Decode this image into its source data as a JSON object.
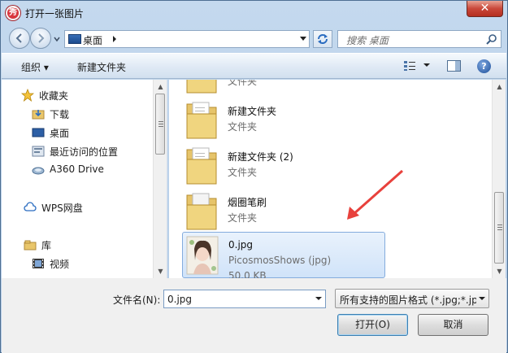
{
  "window": {
    "title": "打开一张图片",
    "app_icon_glyph": "秀",
    "close_glyph": "✕"
  },
  "navbar": {
    "address": "桌面",
    "search_placeholder": "搜索 桌面"
  },
  "toolbar": {
    "organize": "组织 ▾",
    "new_folder": "新建文件夹"
  },
  "sidebar": {
    "items": [
      {
        "label": "收藏夹",
        "icon": "star-icon"
      },
      {
        "label": "下载",
        "icon": "download-folder-icon"
      },
      {
        "label": "桌面",
        "icon": "desktop-icon"
      },
      {
        "label": "最近访问的位置",
        "icon": "recent-places-icon"
      },
      {
        "label": "A360 Drive",
        "icon": "cloud-drive-icon"
      },
      {
        "label": "WPS网盘",
        "icon": "cloud-icon"
      },
      {
        "label": "库",
        "icon": "library-icon"
      },
      {
        "label": "视频",
        "icon": "video-icon"
      }
    ]
  },
  "files": [
    {
      "name": "",
      "type": "文件夹",
      "icon": "folder-icon"
    },
    {
      "name": "新建文件夹",
      "type": "文件夹",
      "icon": "folder-icon"
    },
    {
      "name": "新建文件夹 (2)",
      "type": "文件夹",
      "icon": "folder-icon"
    },
    {
      "name": "烟圈笔刷",
      "type": "文件夹",
      "icon": "folder-icon"
    },
    {
      "name": "0.jpg",
      "type": "PicosmosShows (jpg)",
      "size": "50.0 KB",
      "icon": "image-thumbnail-icon",
      "selected": true
    }
  ],
  "bottom": {
    "filename_label": "文件名(N):",
    "filename_value": "0.jpg",
    "filter": "所有支持的图片格式 (*.jpg;*.jp",
    "open_button": "打开(O)",
    "cancel_button": "取消"
  },
  "colors": {
    "annotation_arrow": "#e8413c",
    "selection_border": "#84acdd",
    "selection_fill": "#d9e8fa"
  }
}
